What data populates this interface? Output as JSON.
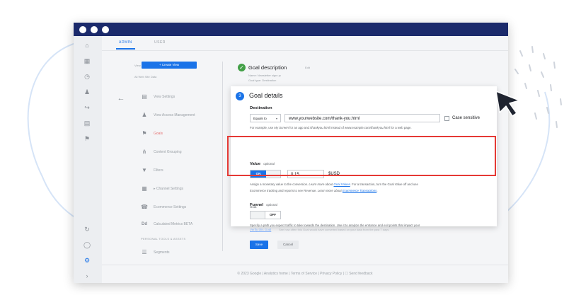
{
  "window": {
    "tabs": [
      {
        "label": "ADMIN"
      },
      {
        "label": "USER"
      }
    ],
    "left_rail_icons": [
      "home-icon",
      "reports-icon",
      "clock-icon",
      "person-icon",
      "acquisition-icon",
      "behavior-icon",
      "flag-icon",
      "attribution-icon",
      "lightbulb-icon",
      "gear-icon",
      "expand-icon"
    ]
  },
  "view_column": {
    "view_label": "View",
    "create_view_label": "+ Create View",
    "view_select": "All Web Site Data",
    "menu": [
      {
        "label": "View Settings",
        "icon": "document-icon"
      },
      {
        "label": "View Access Management",
        "icon": "people-icon"
      },
      {
        "label": "Goals",
        "icon": "flag-icon",
        "active": true
      },
      {
        "label": "Content Grouping",
        "icon": "grouping-icon"
      },
      {
        "label": "Filters",
        "icon": "filter-icon"
      },
      {
        "label": "▸ Channel Settings",
        "icon": "channel-icon"
      },
      {
        "label": "Ecommerce Settings",
        "icon": "cart-icon"
      },
      {
        "label": "Calculated Metrics BETA",
        "icon": "dd-icon"
      },
      {
        "label": "Segments",
        "icon": "segments-icon"
      }
    ],
    "personal_header": "PERSONAL TOOLS & ASSETS"
  },
  "goal_description": {
    "title": "Goal description",
    "edit": "Edit",
    "name_line": "Name: Newsletter sign up",
    "type_line": "Goal type: Destination"
  },
  "goal_details": {
    "step_number": "3",
    "title": "Goal details",
    "destination": {
      "label": "Destination",
      "match_type": "Equals to",
      "url": "www.yourwebsite.com/thank-you.html",
      "case_sensitive_label": "Case sensitive",
      "help_prefix": "For example, use ",
      "help_em1": "My Screen",
      "help_mid": " for an app and ",
      "help_em2": "/thankyou.html",
      "help_mid2": " instead of ",
      "help_em3": "www.example.com/thankyou.html",
      "help_suffix": " for a web page."
    },
    "value": {
      "label": "Value",
      "optional": "optional",
      "toggle_label": "ON",
      "amount": "0.15",
      "currency": "$USD",
      "help_line1_a": "Assign a monetary value to the conversion. ",
      "help_line1_em": "Learn more about ",
      "help_line1_link": "Goal Values",
      "help_line1_b": ". For a transaction, turn the Goal Value off and use",
      "help_line2_a": "Ecommerce tracking and reports to see Revenue. ",
      "help_line2_em": "Learn more about ",
      "help_line2_link": "Ecommerce Transactions",
      "help_line2_b": "."
    },
    "funnel": {
      "label": "Funnel",
      "optional": "optional",
      "toggle_label": "OFF",
      "help_line1": "Specify a path you expect traffic to take towards the destination. Use it to analyze the entrance and exit points that impact your",
      "help_line2": "Goal."
    }
  },
  "bottom": {
    "verify_link": "Verify this Goal",
    "verify_desc": "See how often this Goal would have converted based on your data from the past 7 days.",
    "save_label": "Save",
    "cancel_label": "Cancel"
  },
  "footer": {
    "text": "© 2023 Google | Analytics home | Terms of Service | Privacy Policy | ☐ Send feedback"
  },
  "colors": {
    "titlebar": "#1b2a6b",
    "accent": "#1a73e8",
    "highlight": "#e53935",
    "success": "#43a047"
  }
}
